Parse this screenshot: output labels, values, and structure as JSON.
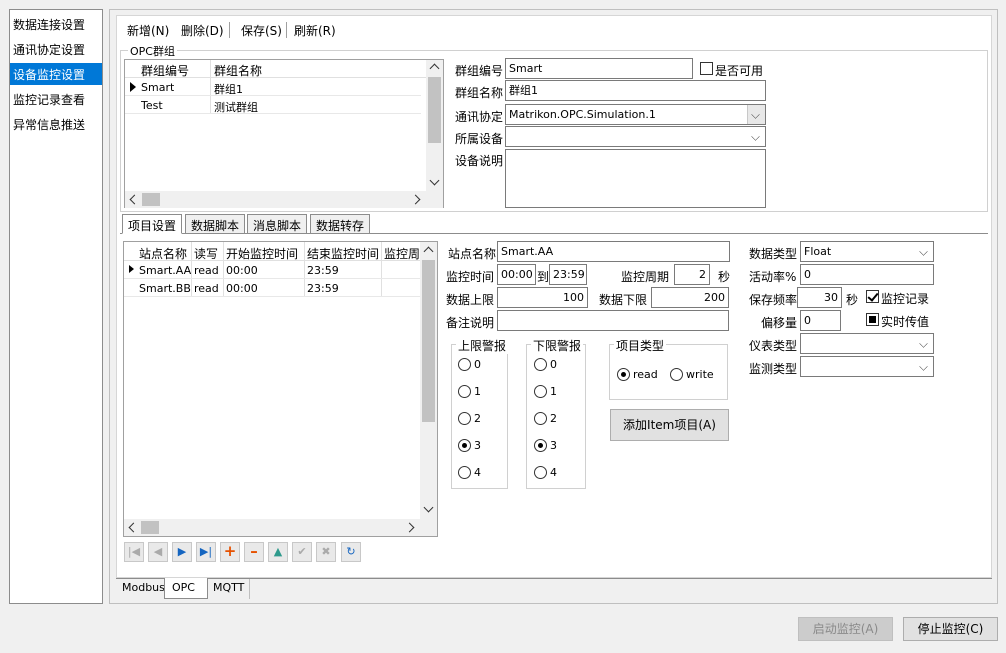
{
  "sidebar": {
    "items": [
      {
        "label": "数据连接设置"
      },
      {
        "label": "通讯协定设置"
      },
      {
        "label": "设备监控设置"
      },
      {
        "label": "监控记录查看"
      },
      {
        "label": "异常信息推送"
      }
    ],
    "selected_index": 2
  },
  "toolbar": {
    "new": "新增(N)",
    "delete": "删除(D)",
    "save": "保存(S)",
    "refresh": "刷新(R)"
  },
  "opc_group": {
    "title": "OPC群组",
    "columns": [
      "群组编号",
      "群组名称"
    ],
    "rows": [
      {
        "id": "Smart",
        "name": "群组1",
        "current": true
      },
      {
        "id": "Test",
        "name": "测试群组",
        "current": false
      }
    ],
    "form": {
      "id_label": "群组编号",
      "id_value": "Smart",
      "enabled_label": "是否可用",
      "enabled": false,
      "name_label": "群组名称",
      "name_value": "群组1",
      "protocol_label": "通讯协定",
      "protocol_value": "Matrikon.OPC.Simulation.1",
      "device_label": "所属设备",
      "device_value": "",
      "desc_label": "设备说明",
      "desc_value": ""
    }
  },
  "inner_tabs": [
    "项目设置",
    "数据脚本",
    "消息脚本",
    "数据转存"
  ],
  "inner_tab_active": 0,
  "items_grid": {
    "columns": [
      "站点名称",
      "读写",
      "开始监控时间",
      "结束监控时间",
      "监控周"
    ],
    "rows": [
      {
        "name": "Smart.AA",
        "rw": "read",
        "start": "00:00",
        "end": "23:59",
        "current": true
      },
      {
        "name": "Smart.BB",
        "rw": "read",
        "start": "00:00",
        "end": "23:59",
        "current": false
      }
    ]
  },
  "item_form": {
    "station_label": "站点名称",
    "station_value": "Smart.AA",
    "time_label": "监控时间",
    "time_from": "00:00",
    "time_to_label": "到",
    "time_to": "23:59",
    "period_label": "监控周期",
    "period_value": "2",
    "period_unit": "秒",
    "upper_label": "数据上限",
    "upper_value": "100",
    "lower_label": "数据下限",
    "lower_value": "200",
    "remark_label": "备注说明",
    "remark_value": "",
    "data_type_label": "数据类型",
    "data_type_value": "Float",
    "active_rate_label": "活动率%",
    "active_rate_value": "0",
    "save_freq_label": "保存频率",
    "save_freq_value": "30",
    "save_freq_unit": "秒",
    "monitor_record_label": "监控记录",
    "monitor_record": true,
    "realtime_label": "实时传值",
    "realtime": true,
    "offset_label": "偏移量",
    "offset_value": "0",
    "meter_type_label": "仪表类型",
    "meter_type_value": "",
    "detect_type_label": "监测类型",
    "detect_type_value": "",
    "upper_alarm_title": "上限警报",
    "lower_alarm_title": "下限警报",
    "alarm_options": [
      "0",
      "1",
      "2",
      "3",
      "4"
    ],
    "upper_alarm_selected": 3,
    "lower_alarm_selected": 3,
    "item_type_title": "项目类型",
    "item_type_options": [
      "read",
      "write"
    ],
    "item_type_selected": 0,
    "add_item_button": "添加Item项目(A)"
  },
  "bottom_tabs": [
    "Modbus",
    "OPC",
    "MQTT"
  ],
  "bottom_tab_active": 1,
  "footer": {
    "start_button": "启动监控(A)",
    "stop_button": "停止监控(C)"
  },
  "colors": {
    "selection": "#0078d7",
    "background": "#f0f0f0",
    "nav_icon_blue": "#1565c0",
    "nav_icon_orange": "#e65100",
    "nav_icon_green": "#2e9a8c"
  }
}
